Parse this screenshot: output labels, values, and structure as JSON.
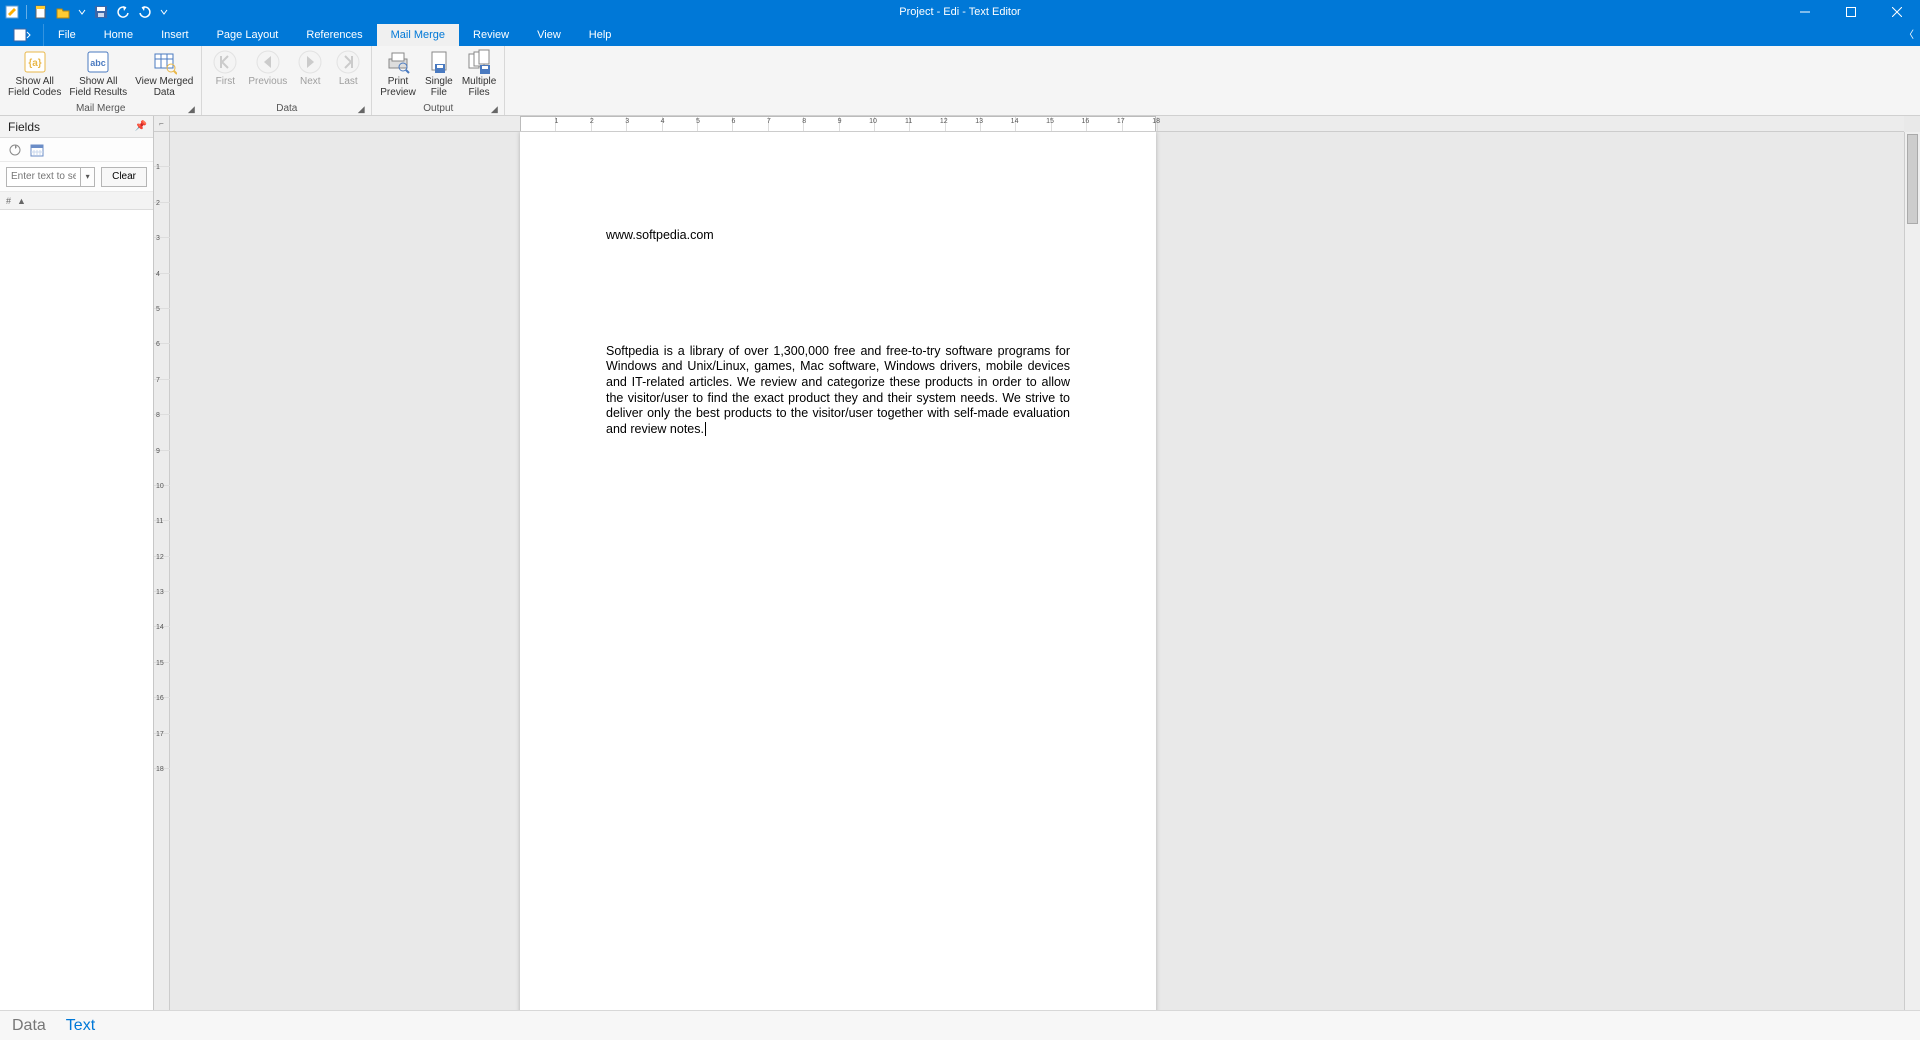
{
  "window": {
    "title": "Project - Edi - Text Editor"
  },
  "qat_icons": [
    "edit-icon",
    "new-icon",
    "open-icon",
    "dropdown-icon",
    "save-icon",
    "undo-icon",
    "redo-icon",
    "dropdown-icon"
  ],
  "ribbon_tabs": [
    "File",
    "Home",
    "Insert",
    "Page Layout",
    "References",
    "Mail Merge",
    "Review",
    "View",
    "Help"
  ],
  "ribbon_active_index": 5,
  "ribbon_groups": {
    "mail_merge": {
      "label": "Mail Merge",
      "buttons": [
        {
          "label": "Show All\nField Codes",
          "icon": "field-codes"
        },
        {
          "label": "Show All\nField Results",
          "icon": "field-results"
        },
        {
          "label": "View Merged\nData",
          "icon": "view-merged"
        }
      ]
    },
    "data": {
      "label": "Data",
      "buttons": [
        {
          "label": "First",
          "icon": "nav-first",
          "disabled": true
        },
        {
          "label": "Previous",
          "icon": "nav-prev",
          "disabled": true
        },
        {
          "label": "Next",
          "icon": "nav-next",
          "disabled": true
        },
        {
          "label": "Last",
          "icon": "nav-last",
          "disabled": true
        }
      ]
    },
    "output": {
      "label": "Output",
      "buttons": [
        {
          "label": "Print\nPreview",
          "icon": "print-preview"
        },
        {
          "label": "Single\nFile",
          "icon": "single-file"
        },
        {
          "label": "Multiple\nFiles",
          "icon": "multiple-files"
        }
      ]
    }
  },
  "side_panel": {
    "title": "Fields",
    "search_placeholder": "Enter text to se",
    "clear_label": "Clear",
    "col_symbols": [
      "#",
      "▲"
    ]
  },
  "document": {
    "url_line": "www.softpedia.com",
    "body_text": "Softpedia is a library of over 1,300,000 free and free-to-try software programs for Windows and Unix/Linux, games, Mac software, Windows drivers, mobile devices and IT-related articles. We review and categorize these products in order to allow the visitor/user to find the exact product they and their system needs. We strive to deliver only the best products to the visitor/user together with self-made evaluation and review notes."
  },
  "status_tabs": [
    "Data",
    "Text"
  ],
  "status_active_index": 1,
  "ruler_h_marks": [
    1,
    2,
    3,
    4,
    5,
    6,
    7,
    8,
    9,
    10,
    11,
    12,
    13,
    14,
    15,
    16,
    17,
    18
  ],
  "ruler_v_marks": [
    1,
    2,
    3,
    4,
    5,
    6,
    7,
    8,
    9,
    10,
    11,
    12,
    13,
    14,
    15,
    16,
    17,
    18
  ]
}
